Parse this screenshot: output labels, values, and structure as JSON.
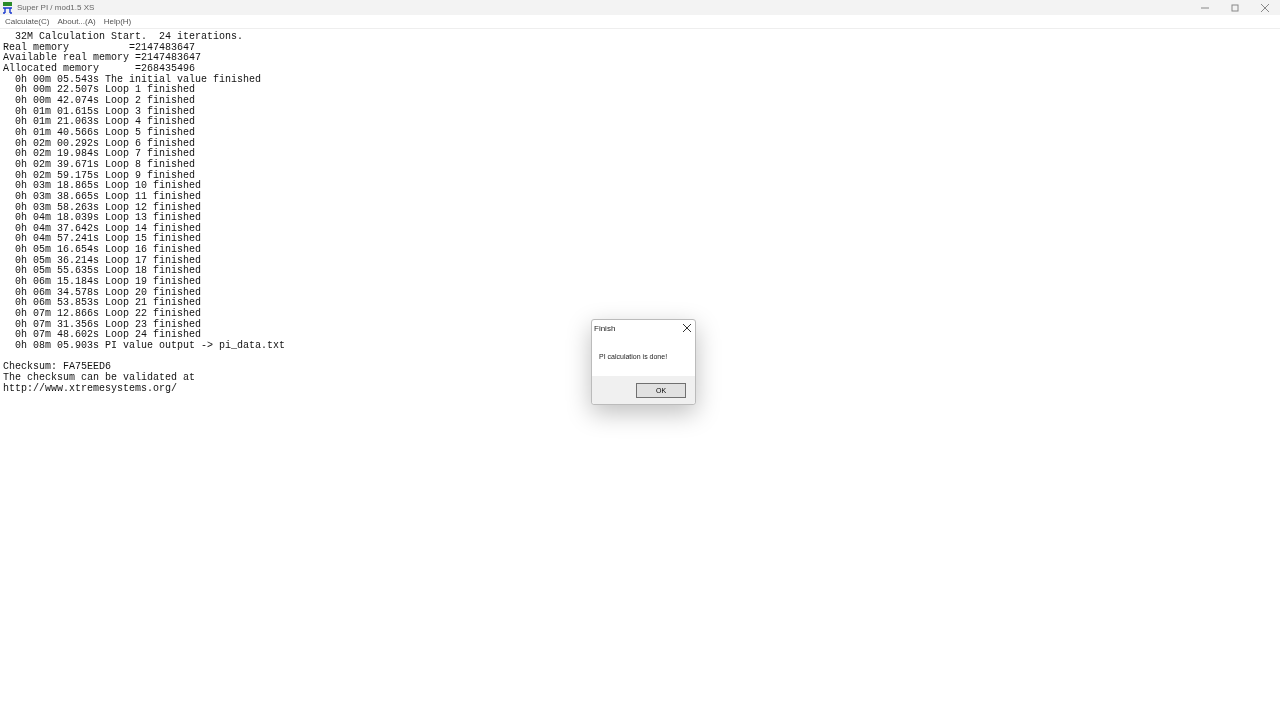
{
  "window": {
    "title": "Super PI / mod1.5 XS"
  },
  "menu": [
    "Calculate(C)",
    "About...(A)",
    "Help(H)"
  ],
  "log_lines": [
    "  32M Calculation Start.  24 iterations.",
    "Real memory          =2147483647",
    "Available real memory =2147483647",
    "Allocated memory      =268435496",
    "  0h 00m 05.543s The initial value finished",
    "  0h 00m 22.507s Loop 1 finished",
    "  0h 00m 42.074s Loop 2 finished",
    "  0h 01m 01.615s Loop 3 finished",
    "  0h 01m 21.063s Loop 4 finished",
    "  0h 01m 40.566s Loop 5 finished",
    "  0h 02m 00.292s Loop 6 finished",
    "  0h 02m 19.984s Loop 7 finished",
    "  0h 02m 39.671s Loop 8 finished",
    "  0h 02m 59.175s Loop 9 finished",
    "  0h 03m 18.865s Loop 10 finished",
    "  0h 03m 38.665s Loop 11 finished",
    "  0h 03m 58.263s Loop 12 finished",
    "  0h 04m 18.039s Loop 13 finished",
    "  0h 04m 37.642s Loop 14 finished",
    "  0h 04m 57.241s Loop 15 finished",
    "  0h 05m 16.654s Loop 16 finished",
    "  0h 05m 36.214s Loop 17 finished",
    "  0h 05m 55.635s Loop 18 finished",
    "  0h 06m 15.184s Loop 19 finished",
    "  0h 06m 34.578s Loop 20 finished",
    "  0h 06m 53.853s Loop 21 finished",
    "  0h 07m 12.866s Loop 22 finished",
    "  0h 07m 31.356s Loop 23 finished",
    "  0h 07m 48.602s Loop 24 finished",
    "  0h 08m 05.903s PI value output -> pi_data.txt"
  ],
  "checksum_lines": [
    "Checksum: FA75EED6",
    "The checksum can be validated at",
    "http://www.xtremesystems.org/"
  ],
  "dialog": {
    "title": "Finish",
    "message": "PI calculation is done!",
    "button": "OK"
  }
}
